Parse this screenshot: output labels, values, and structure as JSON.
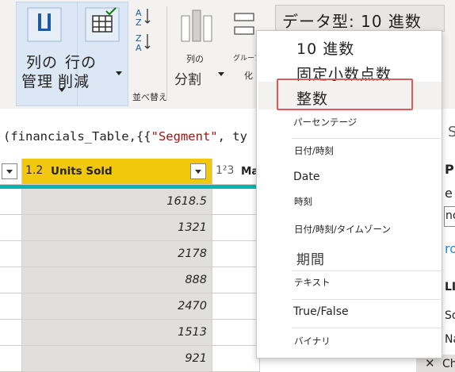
{
  "ribbon": {
    "choose_columns": {
      "line1": "列の",
      "line2": "管理"
    },
    "remove_rows": {
      "line1": "行の",
      "line2": "削減"
    },
    "sort_group_label": "並べ替え",
    "split_column": {
      "line1": "列の",
      "line2": "分割"
    },
    "group_by": {
      "line1": "グループ",
      "line2": "化"
    },
    "data_type_label": "データ型: 10 進数"
  },
  "formula": {
    "prefix": "(financials_Table,{{",
    "segment": "\"Segment\"",
    "suffix": ", ty"
  },
  "grid": {
    "col_units_sold": {
      "type_icon": "1.2",
      "name": "Units Sold"
    },
    "col_next": {
      "type_icon": "1²3",
      "name": "Ma"
    },
    "values": [
      "1618.5",
      "1321",
      "2178",
      "888",
      "2470",
      "1513",
      "921"
    ]
  },
  "side_pane": {
    "s": "S",
    "p": "P",
    "e": "e",
    "no": "no",
    "ro": "ro",
    "li": "LI",
    "so": "So",
    "na": "Na",
    "ch": "Ch",
    "close_glyph": "✕"
  },
  "data_type_menu": {
    "items": [
      "10 進数",
      "固定小数点数",
      "整数",
      "パーセンテージ",
      "日付/時刻",
      "Date",
      "時刻",
      "日付/時刻/タイムゾーン",
      "期間",
      "テキスト",
      "True/False",
      "バイナリ"
    ],
    "highlighted_item": "整数"
  },
  "colors": {
    "accent_header": "#f2c80f",
    "teal_bar": "#01b8aa",
    "highlight_box": "#e05a5a",
    "string_literal": "#a31515"
  }
}
